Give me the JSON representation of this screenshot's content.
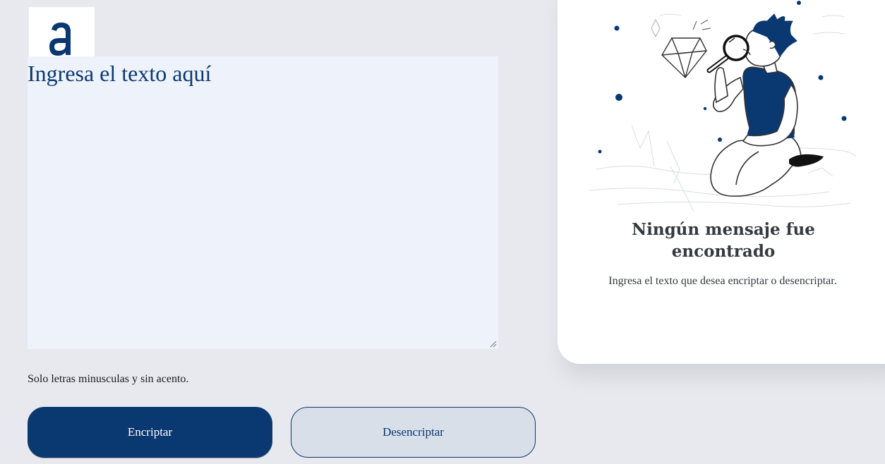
{
  "logo": {
    "text": "a",
    "icon": "alura-logo-icon"
  },
  "input": {
    "placeholder": "Ingresa el texto aquí",
    "value": ""
  },
  "hint": {
    "text": "Solo letras minusculas y sin acento.",
    "icon": "info-icon"
  },
  "buttons": {
    "encrypt_label": "Encriptar",
    "decrypt_label": "Desencriptar"
  },
  "output": {
    "title": "Ningún mensaje fue encontrado",
    "description": "Ingresa el texto que desea encriptar o desencriptar.",
    "illustration": "person-with-magnifier-illustration"
  },
  "colors": {
    "background": "#e8e9ee",
    "accent": "#0a3871",
    "text_area_bg": "#eef3fb",
    "secondary_button_bg": "#d8dfe8",
    "card_bg": "#ffffff",
    "muted_text": "#343a40"
  }
}
